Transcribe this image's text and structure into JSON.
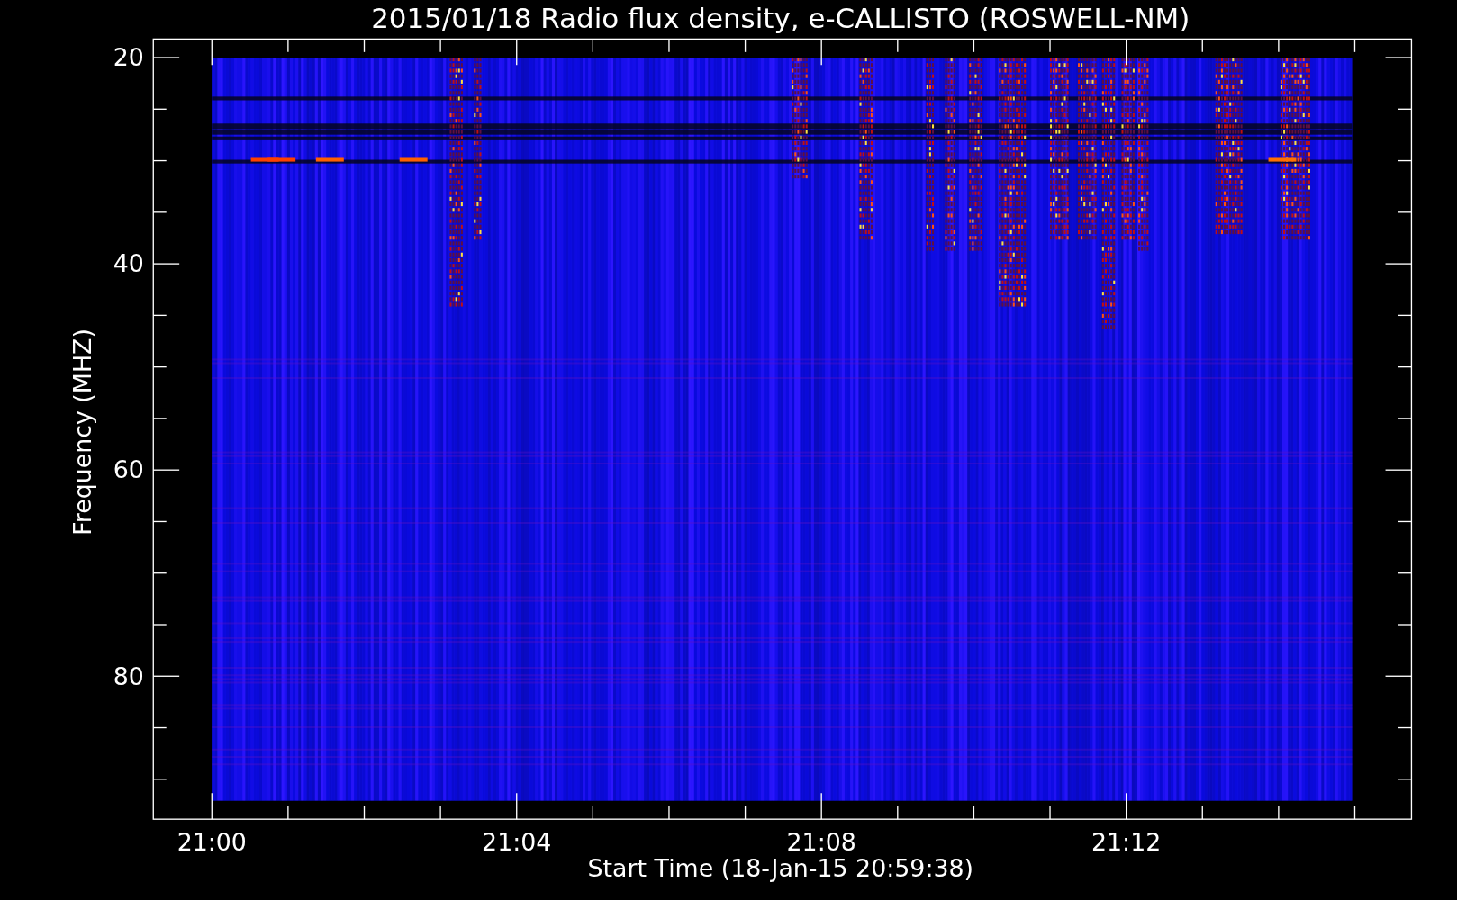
{
  "title": "2015/01/18  Radio flux density, e-CALLISTO (ROSWELL-NM)",
  "plot": {
    "x_axis": {
      "label": "Start Time (18-Jan-15 20:59:38)",
      "ticks": [
        "21:00",
        "21:04",
        "21:08",
        "21:12"
      ]
    },
    "y_axis": {
      "label": "Frequency (MHZ)",
      "ticks": [
        "20",
        "40",
        "60",
        "80"
      ]
    }
  }
}
